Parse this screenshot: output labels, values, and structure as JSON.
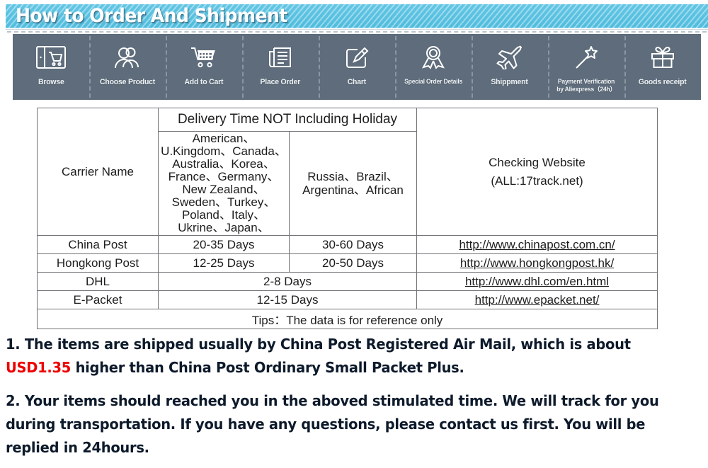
{
  "banner": {
    "title": "How to Order And Shipment",
    "bg_color": "#4fbcdd",
    "text_color": "#ffffff"
  },
  "steps_bar": {
    "bg_color": "#5e6c7b",
    "steps": [
      {
        "icon": "browse-window-cart-icon",
        "label": "Browse"
      },
      {
        "icon": "user-group-icon",
        "label": "Choose Product"
      },
      {
        "icon": "shopping-cart-icon",
        "label": "Add to Cart"
      },
      {
        "icon": "document-lines-icon",
        "label": "Place Order"
      },
      {
        "icon": "pencil-square-icon",
        "label": "Chart"
      },
      {
        "icon": "award-ribbon-icon",
        "label": "Special Order Details"
      },
      {
        "icon": "airplane-icon",
        "label": "Shippment"
      },
      {
        "icon": "magic-wand-star-icon",
        "label": "Payment Verification\nby Aliexpress（24h）"
      },
      {
        "icon": "gift-box-icon",
        "label": "Goods receipt"
      }
    ]
  },
  "table": {
    "headers": {
      "carrier_name": "Carrier Name",
      "delivery_time_group": "Delivery Time NOT Including Holiday",
      "region_1": "American、U.Kingdom、Canada、Australia、Korea、France、Germany、New Zealand、Sweden、Turkey、Poland、Italy、Ukrine、Japan、",
      "region_2": "Russia、Brazil、Argentina、African",
      "checking_website_line1": "Checking Website",
      "checking_website_line2": "(ALL:17track.net)"
    },
    "rows": [
      {
        "carrier": "China Post",
        "time_region_1": "20-35 Days",
        "time_region_2": "30-60 Days",
        "merged_time": false,
        "website": "http://www.chinapost.com.cn/"
      },
      {
        "carrier": "Hongkong Post",
        "time_region_1": "12-25 Days",
        "time_region_2": "20-50 Days",
        "merged_time": false,
        "website": "http://www.hongkongpost.hk/"
      },
      {
        "carrier": "DHL",
        "time_merged": "2-8 Days",
        "merged_time": true,
        "website": "http://www.dhl.com/en.html"
      },
      {
        "carrier": "E-Packet",
        "time_merged": "12-15 Days",
        "merged_time": true,
        "website": "http://www.epacket.net/"
      }
    ],
    "tips": "Tips：The data is for reference only"
  },
  "notes": {
    "note_1_prefix": "1. The items are shipped usually by China Post Registered Air Mail, which is about ",
    "note_1_price": "USD1.35",
    "note_1_suffix": " higher than China Post Ordinary Small Packet Plus.",
    "note_2": "2. Your items should reached you in the aboved stimulated time. We will track for you during transportation. If you have any questions, please contact us first. You will be replied in 24hours.",
    "price_color": "#ee0000",
    "text_color": "#0d1a2b"
  }
}
